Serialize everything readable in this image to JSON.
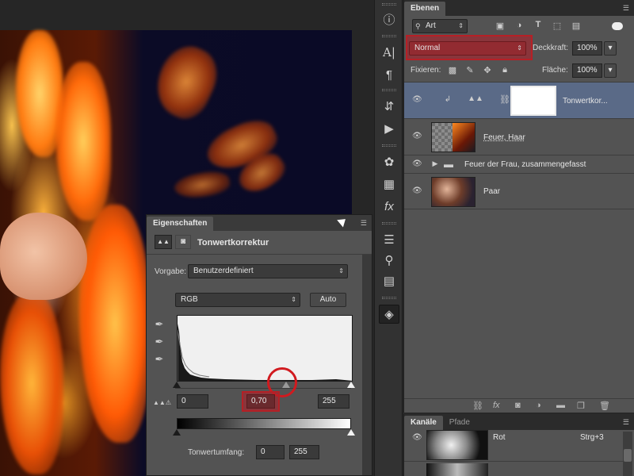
{
  "layers_panel": {
    "tab_label": "Ebenen",
    "filter_select": "Art",
    "blend_mode": "Normal",
    "opacity_label": "Deckkraft:",
    "opacity_value": "100%",
    "lock_label": "Fixieren:",
    "fill_label": "Fläche:",
    "fill_value": "100%",
    "layers": [
      {
        "name": "Tonwertkor...",
        "selected": true
      },
      {
        "name": "Feuer, Haar",
        "selected": false
      },
      {
        "name": "Feuer der Frau, zusammengefasst",
        "selected": false
      },
      {
        "name": "Paar",
        "selected": false
      }
    ]
  },
  "channels_panel": {
    "tabs": [
      "Kanäle",
      "Pfade"
    ],
    "channel_name": "Rot",
    "channel_shortcut": "Strg+3"
  },
  "properties_panel": {
    "tab_label": "Eigenschaften",
    "title": "Tonwertkorrektur",
    "preset_label": "Vorgabe:",
    "preset_value": "Benutzerdefiniert",
    "channel_value": "RGB",
    "auto_label": "Auto",
    "input_black": "0",
    "input_gamma": "0,70",
    "input_white": "255",
    "output_label": "Tonwertumfang:",
    "output_black": "0",
    "output_white": "255",
    "gamma_slider_position": 0.62
  },
  "colors": {
    "highlight": "#b52026",
    "selected_layer": "#5a6a87",
    "panel_bg": "#535353"
  },
  "icons": {
    "tools": [
      "info-icon",
      "character-icon",
      "paragraph-icon",
      "history-icon",
      "play-icon",
      "brush-preset-icon",
      "swatches-icon",
      "styles-icon",
      "clone-source-icon",
      "tool-preset-icon",
      "layer-comps-icon",
      "3d-icon"
    ]
  }
}
